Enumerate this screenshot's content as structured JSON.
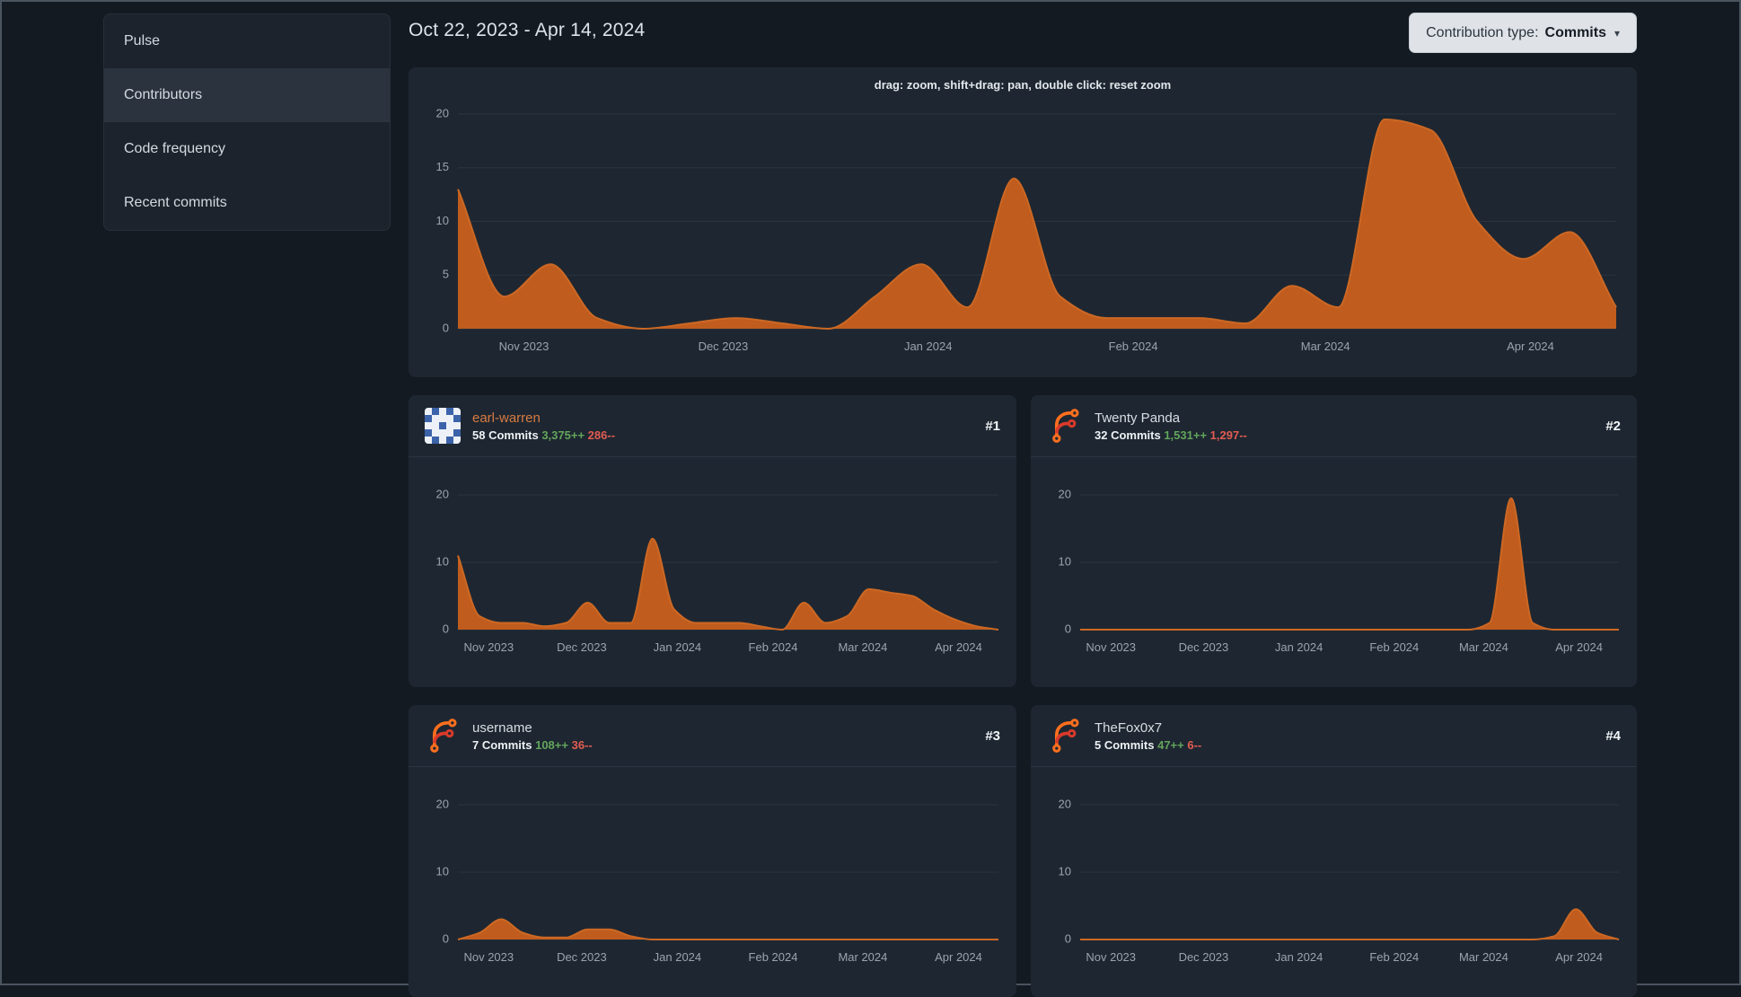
{
  "sidebar": {
    "items": [
      {
        "label": "Pulse",
        "active": false
      },
      {
        "label": "Contributors",
        "active": true
      },
      {
        "label": "Code frequency",
        "active": false
      },
      {
        "label": "Recent commits",
        "active": false
      }
    ]
  },
  "header": {
    "date_range": "Oct 22, 2023 - Apr 14, 2024",
    "contribution_type_label": "Contribution type:",
    "contribution_type_value": "Commits",
    "caret_icon": "▾"
  },
  "colors": {
    "page_background": "#141a22",
    "card_background": "#1e2731",
    "chart_fill_orange": "#c05c1d",
    "chart_stroke_orange": "#cd6824",
    "additions_green": "#63a55c",
    "deletions_red": "#e15c52",
    "link_orange": "#d87a41"
  },
  "contributors": [
    {
      "name": "earl-warren",
      "rank": "#1",
      "commits": "58 Commits",
      "additions": "3,375++",
      "deletions": "286--",
      "avatar": "identicon-blue-white"
    },
    {
      "name": "Twenty Panda",
      "rank": "#2",
      "commits": "32 Commits",
      "additions": "1,531++",
      "deletions": "1,297--",
      "avatar": "forgejo-logo"
    },
    {
      "name": "username",
      "rank": "#3",
      "commits": "7 Commits",
      "additions": "108++",
      "deletions": "36--",
      "avatar": "forgejo-logo"
    },
    {
      "name": "TheFox0x7",
      "rank": "#4",
      "commits": "5 Commits",
      "additions": "47++",
      "deletions": "6--",
      "avatar": "forgejo-logo"
    }
  ],
  "chart_data": [
    {
      "id": "overall-commits",
      "type": "area",
      "title": "drag: zoom, shift+drag: pan, double click: reset zoom",
      "x_unit": "week",
      "x_range": [
        "Oct 22, 2023",
        "Apr 14, 2024"
      ],
      "values": [
        13,
        3,
        6,
        1,
        0,
        0.5,
        1,
        0.5,
        0,
        3,
        6,
        2,
        14,
        3,
        1,
        1,
        1,
        0.5,
        4,
        2,
        19.5,
        18.5,
        10,
        6.5,
        9,
        2
      ],
      "ylim": [
        0,
        20
      ],
      "yticks": [
        0,
        5,
        10,
        15,
        20
      ],
      "xticks": [
        {
          "label": "Nov 2023",
          "pos": 0.057
        },
        {
          "label": "Dec 2023",
          "pos": 0.229
        },
        {
          "label": "Jan 2024",
          "pos": 0.406
        },
        {
          "label": "Feb 2024",
          "pos": 0.583
        },
        {
          "label": "Mar 2024",
          "pos": 0.749
        },
        {
          "label": "Apr 2024",
          "pos": 0.926
        }
      ],
      "grid": true,
      "legend": "none",
      "color": "#c05c1d",
      "stroke": "#cd6824"
    },
    {
      "id": "earl-warren-commits",
      "type": "area",
      "title": "earl-warren weekly commits",
      "x_unit": "week",
      "values": [
        11,
        2,
        1,
        1,
        0.5,
        1,
        4,
        1,
        1,
        13.5,
        3,
        1,
        1,
        1,
        0.5,
        0,
        4,
        1,
        2,
        6,
        5.5,
        5,
        3,
        1.5,
        0.5,
        0
      ],
      "ylim": [
        0,
        20
      ],
      "yticks": [
        0,
        10,
        20
      ],
      "xticks": [
        {
          "label": "Nov 2023",
          "pos": 0.057
        },
        {
          "label": "Dec 2023",
          "pos": 0.229
        },
        {
          "label": "Jan 2024",
          "pos": 0.406
        },
        {
          "label": "Feb 2024",
          "pos": 0.583
        },
        {
          "label": "Mar 2024",
          "pos": 0.749
        },
        {
          "label": "Apr 2024",
          "pos": 0.926
        }
      ],
      "grid": true,
      "legend": "none",
      "color": "#c05c1d",
      "stroke": "#cd6824"
    },
    {
      "id": "twenty-panda-commits",
      "type": "area",
      "title": "Twenty Panda weekly commits",
      "x_unit": "week",
      "values": [
        0,
        0,
        0,
        0,
        0,
        0,
        0,
        0,
        0,
        0,
        0,
        0,
        0,
        0,
        0,
        0,
        0,
        0,
        0,
        1,
        19.5,
        1,
        0,
        0,
        0,
        0
      ],
      "ylim": [
        0,
        20
      ],
      "yticks": [
        0,
        10,
        20
      ],
      "xticks": [
        {
          "label": "Nov 2023",
          "pos": 0.057
        },
        {
          "label": "Dec 2023",
          "pos": 0.229
        },
        {
          "label": "Jan 2024",
          "pos": 0.406
        },
        {
          "label": "Feb 2024",
          "pos": 0.583
        },
        {
          "label": "Mar 2024",
          "pos": 0.749
        },
        {
          "label": "Apr 2024",
          "pos": 0.926
        }
      ],
      "grid": true,
      "legend": "none",
      "color": "#c05c1d",
      "stroke": "#cd6824"
    },
    {
      "id": "username-commits",
      "type": "area",
      "title": "username weekly commits",
      "x_unit": "week",
      "values": [
        0,
        1,
        3,
        1,
        0.3,
        0.3,
        1.5,
        1.5,
        0.5,
        0,
        0,
        0,
        0,
        0,
        0,
        0,
        0,
        0,
        0,
        0,
        0,
        0,
        0,
        0,
        0,
        0
      ],
      "ylim": [
        0,
        20
      ],
      "yticks": [
        0,
        10,
        20
      ],
      "xticks": [
        {
          "label": "Nov 2023",
          "pos": 0.057
        },
        {
          "label": "Dec 2023",
          "pos": 0.229
        },
        {
          "label": "Jan 2024",
          "pos": 0.406
        },
        {
          "label": "Feb 2024",
          "pos": 0.583
        },
        {
          "label": "Mar 2024",
          "pos": 0.749
        },
        {
          "label": "Apr 2024",
          "pos": 0.926
        }
      ],
      "grid": true,
      "legend": "none",
      "color": "#c05c1d",
      "stroke": "#cd6824"
    },
    {
      "id": "thefox0x7-commits",
      "type": "area",
      "title": "TheFox0x7 weekly commits",
      "x_unit": "week",
      "values": [
        0,
        0,
        0,
        0,
        0,
        0,
        0,
        0,
        0,
        0,
        0,
        0,
        0,
        0,
        0,
        0,
        0,
        0,
        0,
        0,
        0,
        0,
        0.5,
        4.5,
        1,
        0
      ],
      "ylim": [
        0,
        20
      ],
      "yticks": [
        0,
        10,
        20
      ],
      "xticks": [
        {
          "label": "Nov 2023",
          "pos": 0.057
        },
        {
          "label": "Dec 2023",
          "pos": 0.229
        },
        {
          "label": "Jan 2024",
          "pos": 0.406
        },
        {
          "label": "Feb 2024",
          "pos": 0.583
        },
        {
          "label": "Mar 2024",
          "pos": 0.749
        },
        {
          "label": "Apr 2024",
          "pos": 0.926
        }
      ],
      "grid": true,
      "legend": "none",
      "color": "#c05c1d",
      "stroke": "#cd6824"
    }
  ]
}
